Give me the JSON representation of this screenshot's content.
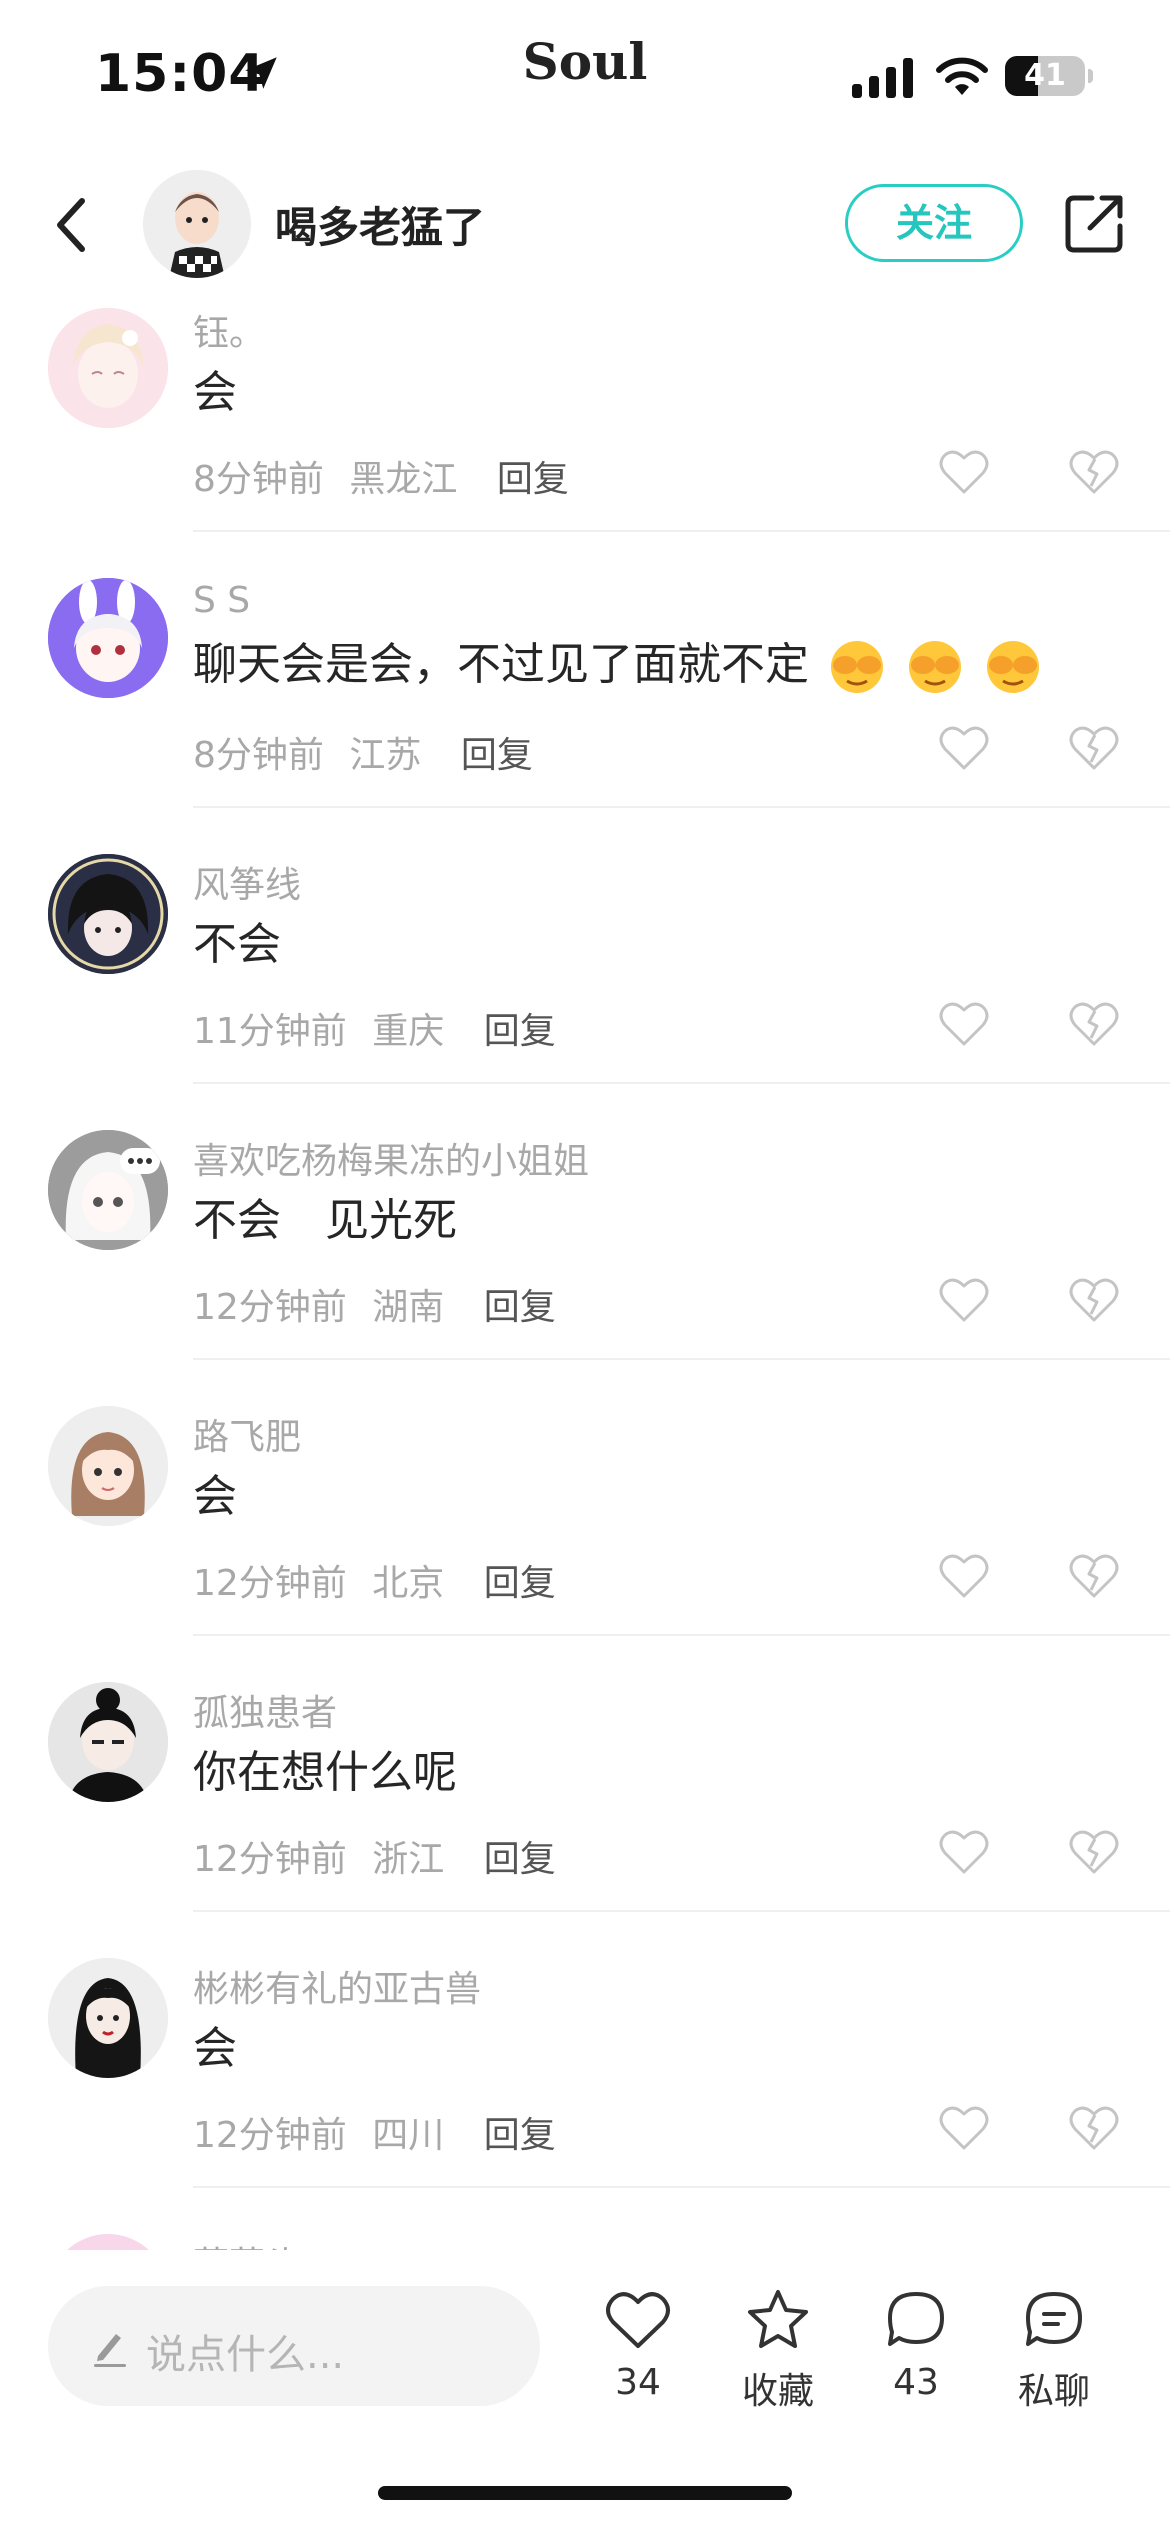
{
  "status_bar": {
    "time": "15:04",
    "app_name": "Soul",
    "battery_level": 41,
    "battery_label": "41"
  },
  "header": {
    "title": "喝多老猛了",
    "follow_label": "关注"
  },
  "comments": [
    {
      "username": "钰。",
      "content": "会",
      "time": "8分钟前",
      "location": "黑龙江",
      "reply": "回复",
      "avatar_color": "#f8dbe3"
    },
    {
      "username": "S S",
      "content": "聊天会是会，不过见了面就不定",
      "emoji_count": 3,
      "time": "8分钟前",
      "location": "江苏",
      "reply": "回复",
      "avatar_color": "#8a6cf0"
    },
    {
      "username": "风筝线",
      "content": "不会",
      "time": "11分钟前",
      "location": "重庆",
      "reply": "回复",
      "avatar_color": "#2a2f45"
    },
    {
      "username": "喜欢吃杨梅果冻的小姐姐",
      "content": "不会　见光死",
      "time": "12分钟前",
      "location": "湖南",
      "reply": "回复",
      "avatar_color": "#9c9c9c"
    },
    {
      "username": "路飞肥",
      "content": "会",
      "time": "12分钟前",
      "location": "北京",
      "reply": "回复",
      "avatar_color": "#eeeeee"
    },
    {
      "username": "孤独患者",
      "content": "你在想什么呢",
      "time": "12分钟前",
      "location": "浙江",
      "reply": "回复",
      "avatar_color": "#e6e6e6"
    },
    {
      "username": "彬彬有礼的亚古兽",
      "content": "会",
      "time": "12分钟前",
      "location": "四川",
      "reply": "回复",
      "avatar_color": "#eeeeee"
    },
    {
      "username": "菜菜头",
      "content": "",
      "time": "",
      "location": "",
      "reply": "",
      "avatar_color": "#f8d7ea"
    }
  ],
  "bottom_bar": {
    "input_placeholder": "说点什么...",
    "like_count": "34",
    "collect_label": "收藏",
    "comment_count": "43",
    "chat_label": "私聊"
  },
  "colors": {
    "accent": "#25c6bd",
    "text_primary": "#262626",
    "text_secondary": "#a8a8a8"
  }
}
